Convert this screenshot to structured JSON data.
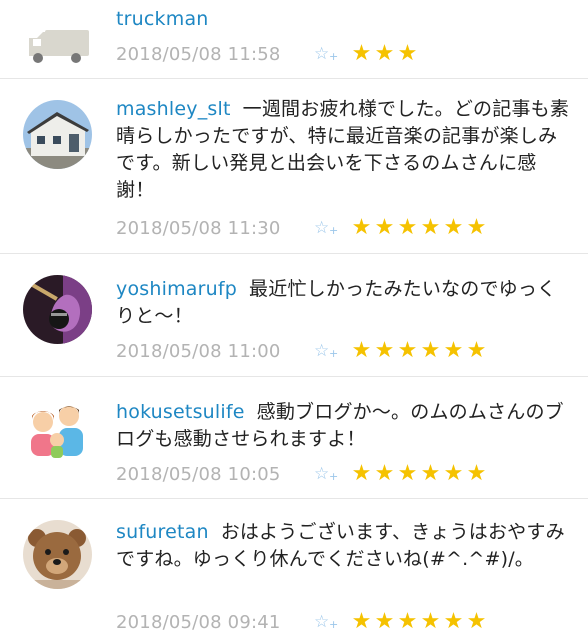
{
  "comments": [
    {
      "username": "truckman",
      "text": "",
      "timestamp": "2018/05/08 11:58",
      "star_count": 3,
      "avatar": "truck-avatar"
    },
    {
      "username": "mashley_slt",
      "text": "一週間お疲れ様でした。どの記事も素晴らしかったですが、特に最近音楽の記事が楽しみです。新しい発見と出会いを下さるのムさんに感謝！",
      "timestamp": "2018/05/08 11:30",
      "star_count": 6,
      "avatar": "house-avatar"
    },
    {
      "username": "yoshimarufp",
      "text": "最近忙しかったみたいなのでゆっくりと～！",
      "timestamp": "2018/05/08 11:00",
      "star_count": 6,
      "avatar": "guitar-avatar"
    },
    {
      "username": "hokusetsulife",
      "text": "感動ブログか～。のムのムさんのブログも感動させられますよ！",
      "timestamp": "2018/05/08 10:05",
      "star_count": 6,
      "avatar": "family-avatar"
    },
    {
      "username": "sufuretan",
      "text": "おはようございます、きょうはおやすみですね。ゆっくり休んでくださいね(#^.^#)/。",
      "timestamp": "2018/05/08 09:41",
      "star_count": 6,
      "avatar": "teddy-bear-avatar"
    }
  ],
  "icons": {
    "star": "★",
    "add_star": "☆",
    "add_star_plus": "+"
  },
  "colors": {
    "username": "#1e87c3",
    "timestamp": "#b3b3b3",
    "star": "#f5c200",
    "add_star": "#9cc7ea"
  }
}
